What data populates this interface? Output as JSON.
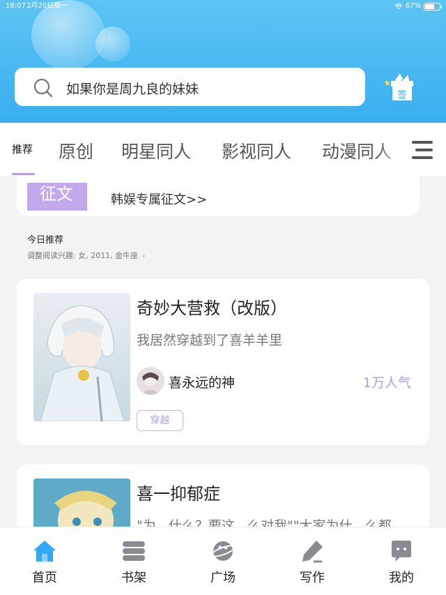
{
  "status_bar": {
    "time": "18:07",
    "date": "2月20日周一",
    "battery": "67%",
    "battery_level": 0.67
  },
  "search": {
    "placeholder": "如果你是周九良的妹妹"
  },
  "checkin": {
    "label": "签"
  },
  "tabs": [
    {
      "label": "推荐",
      "active": true
    },
    {
      "label": "原创"
    },
    {
      "label": "明星同人"
    },
    {
      "label": "影视同人"
    },
    {
      "label": "动漫同人"
    }
  ],
  "contest": {
    "badge": "征文",
    "text": "韩娱专属征文>>"
  },
  "today": {
    "title": "今日推荐",
    "subtitle": "调整阅读兴趣: 女, 2011, 金牛座"
  },
  "books": [
    {
      "title": "奇妙大营救（改版）",
      "description": "我居然穿越到了喜羊羊里",
      "author": "喜永远的神",
      "popularity": "1万人气",
      "tag": "穿越"
    },
    {
      "title": "喜一抑郁症",
      "description": "\"为...什么？要这...么对我\"\"大家为什...么都..."
    }
  ],
  "bottom_nav": [
    {
      "label": "首页",
      "icon": "home-icon",
      "active": true
    },
    {
      "label": "书架",
      "icon": "bookshelf-icon"
    },
    {
      "label": "广场",
      "icon": "planet-icon"
    },
    {
      "label": "写作",
      "icon": "pen-icon"
    },
    {
      "label": "我的",
      "icon": "chat-bubble-icon"
    }
  ],
  "colors": {
    "header_blue": "#3aaef0",
    "accent_purple": "#b79be8",
    "nav_active_blue": "#33a9f5",
    "nav_inactive_gray": "#8a8a92"
  }
}
